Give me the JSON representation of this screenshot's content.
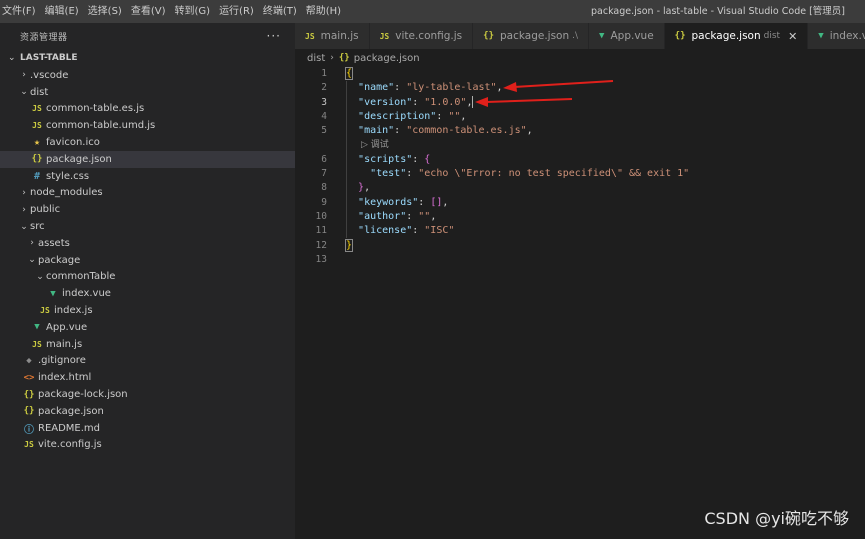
{
  "menu": [
    "文件(F)",
    "编辑(E)",
    "选择(S)",
    "查看(V)",
    "转到(G)",
    "运行(R)",
    "终端(T)",
    "帮助(H)"
  ],
  "window_title": "package.json - last-table - Visual Studio Code [管理员]",
  "sidebar": {
    "title": "资源管理器",
    "more": "···",
    "folder": "LAST-TABLE",
    "items": [
      {
        "label": ".vscode",
        "type": "folder",
        "depth": 0,
        "open": false
      },
      {
        "label": "dist",
        "type": "folder",
        "depth": 0,
        "open": true
      },
      {
        "label": "common-table.es.js",
        "type": "js",
        "depth": 1
      },
      {
        "label": "common-table.umd.js",
        "type": "js",
        "depth": 1
      },
      {
        "label": "favicon.ico",
        "type": "star",
        "depth": 1
      },
      {
        "label": "package.json",
        "type": "json",
        "depth": 1,
        "selected": true
      },
      {
        "label": "style.css",
        "type": "css",
        "depth": 1
      },
      {
        "label": "node_modules",
        "type": "folder",
        "depth": 0,
        "open": false
      },
      {
        "label": "public",
        "type": "folder",
        "depth": 0,
        "open": false
      },
      {
        "label": "src",
        "type": "folder",
        "depth": 0,
        "open": true
      },
      {
        "label": "assets",
        "type": "folder",
        "depth": 1,
        "open": false
      },
      {
        "label": "package",
        "type": "folder",
        "depth": 1,
        "open": true
      },
      {
        "label": "commonTable",
        "type": "folder",
        "depth": 2,
        "open": true
      },
      {
        "label": "index.vue",
        "type": "vue",
        "depth": 3
      },
      {
        "label": "index.js",
        "type": "js",
        "depth": 2
      },
      {
        "label": "App.vue",
        "type": "vue",
        "depth": 1
      },
      {
        "label": "main.js",
        "type": "js",
        "depth": 1
      },
      {
        "label": ".gitignore",
        "type": "git",
        "depth": 0
      },
      {
        "label": "index.html",
        "type": "html",
        "depth": 0
      },
      {
        "label": "package-lock.json",
        "type": "json",
        "depth": 0
      },
      {
        "label": "package.json",
        "type": "json",
        "depth": 0
      },
      {
        "label": "README.md",
        "type": "info",
        "depth": 0
      },
      {
        "label": "vite.config.js",
        "type": "js",
        "depth": 0
      }
    ]
  },
  "tabs": [
    {
      "label": "main.js",
      "type": "js"
    },
    {
      "label": "vite.config.js",
      "type": "js"
    },
    {
      "label": "package.json",
      "hint": ".\\",
      "type": "json"
    },
    {
      "label": "App.vue",
      "type": "vue"
    },
    {
      "label": "package.json",
      "hint": "dist",
      "type": "json",
      "active": true
    },
    {
      "label": "index.vs",
      "type": "vue"
    }
  ],
  "breadcrumb": {
    "folder": "dist",
    "file": "package.json"
  },
  "code": {
    "line_numbers": [
      "1",
      "2",
      "3",
      "4",
      "5",
      "6",
      "7",
      "8",
      "9",
      "10",
      "11",
      "12",
      "13"
    ],
    "codelens": "调试",
    "name_key": "\"name\"",
    "name_val": "\"ly-table-last\"",
    "version_key": "\"version\"",
    "version_val": "\"1.0.0\"",
    "description_key": "\"description\"",
    "description_val": "\"\"",
    "main_key": "\"main\"",
    "main_val": "\"common-table.es.js\"",
    "scripts_key": "\"scripts\"",
    "test_key": "\"test\"",
    "test_val": "\"echo \\\"Error: no test specified\\\" && exit 1\"",
    "keywords_key": "\"keywords\"",
    "keywords_val": "[]",
    "author_key": "\"author\"",
    "author_val": "\"\"",
    "license_key": "\"license\"",
    "license_val": "\"ISC\""
  },
  "watermark": "CSDN @yi碗吃不够",
  "colors": {
    "arrow": "#e0201b",
    "accent": "#007acc"
  }
}
